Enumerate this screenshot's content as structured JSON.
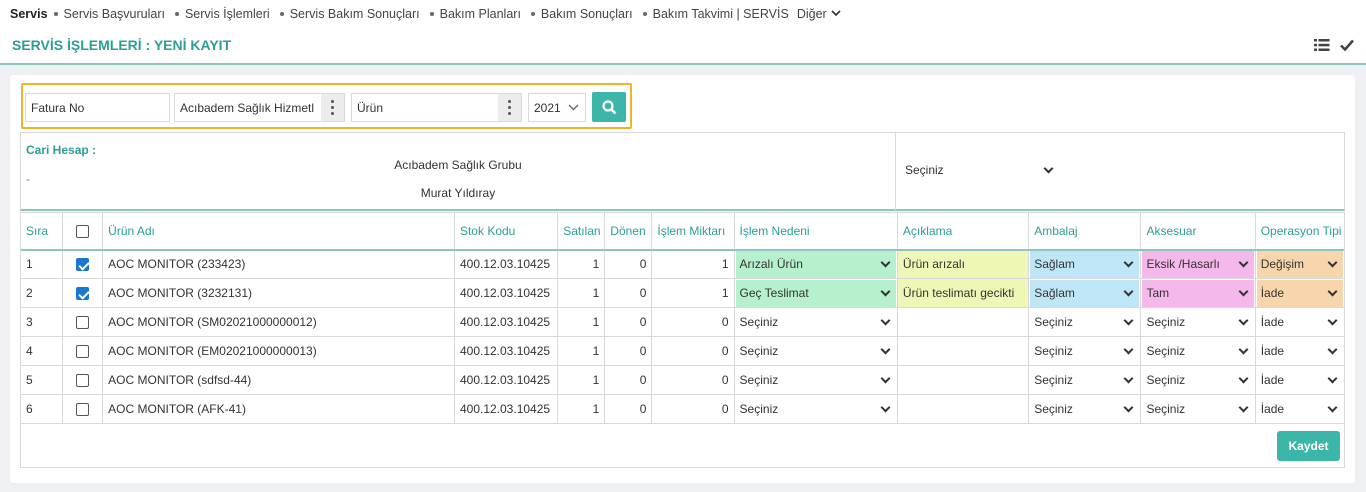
{
  "nav": {
    "brand": "Servis",
    "items": [
      "Servis Başvuruları",
      "Servis İşlemleri",
      "Servis Bakım Sonuçları",
      "Bakım Planları",
      "Bakım Sonuçları",
      "Bakım Takvimi | SERVİS"
    ],
    "more": "Diğer"
  },
  "page": {
    "title": "SERVİS İŞLEMLERİ : YENİ KAYIT"
  },
  "search": {
    "invoice_placeholder": "Fatura No",
    "account_value": "Acıbadem  Sağlık Hizmetl",
    "product_placeholder": "Ürün",
    "year_value": "2021"
  },
  "cari": {
    "label": "Cari Hesap :",
    "dash": "-",
    "group_name": "Acıbadem Sağlık Grubu",
    "contact_name": "Murat Yıldıray",
    "select_value": "Seçiniz"
  },
  "table": {
    "headers": {
      "sira": "Sıra",
      "urun_adi": "Ürün Adı",
      "stok_kodu": "Stok Kodu",
      "satilan": "Satılan",
      "donen": "Dönen",
      "islem_miktari": "İşlem Miktarı",
      "islem_nedeni": "İşlem Nedeni",
      "aciklama": "Açıklama",
      "ambalaj": "Ambalaj",
      "aksesuar": "Aksesuar",
      "operasyon_tipi": "Operasyon Tipi"
    },
    "rows": [
      {
        "sira": "1",
        "checked": true,
        "urun_adi": "AOC MONITOR (233423)",
        "stok_kodu": "400.12.03.10425",
        "satilan": "1",
        "donen": "0",
        "miktar": "1",
        "neden": "Arızalı Ürün",
        "aciklama": "Ürün arızalı",
        "ambalaj": "Sağlam",
        "aksesuar": "Eksik /Hasarlı",
        "operasyon": "Değişim"
      },
      {
        "sira": "2",
        "checked": true,
        "urun_adi": "AOC MONITOR (3232131)",
        "stok_kodu": "400.12.03.10425",
        "satilan": "1",
        "donen": "0",
        "miktar": "1",
        "neden": "Geç Teslimat",
        "aciklama": "Ürün teslimatı gecikti",
        "ambalaj": "Sağlam",
        "aksesuar": "Tam",
        "operasyon": "İade"
      },
      {
        "sira": "3",
        "checked": false,
        "urun_adi": "AOC MONITOR (SM02021000000012)",
        "stok_kodu": "400.12.03.10425",
        "satilan": "1",
        "donen": "0",
        "miktar": "0",
        "neden": "Seçiniz",
        "aciklama": "",
        "ambalaj": "Seçiniz",
        "aksesuar": "Seçiniz",
        "operasyon": "İade"
      },
      {
        "sira": "4",
        "checked": false,
        "urun_adi": "AOC MONITOR (EM02021000000013)",
        "stok_kodu": "400.12.03.10425",
        "satilan": "1",
        "donen": "0",
        "miktar": "0",
        "neden": "Seçiniz",
        "aciklama": "",
        "ambalaj": "Seçiniz",
        "aksesuar": "Seçiniz",
        "operasyon": "İade"
      },
      {
        "sira": "5",
        "checked": false,
        "urun_adi": "AOC MONITOR (sdfsd-44)",
        "stok_kodu": "400.12.03.10425",
        "satilan": "1",
        "donen": "0",
        "miktar": "0",
        "neden": "Seçiniz",
        "aciklama": "",
        "ambalaj": "Seçiniz",
        "aksesuar": "Seçiniz",
        "operasyon": "İade"
      },
      {
        "sira": "6",
        "checked": false,
        "urun_adi": "AOC MONITOR (AFK-41)",
        "stok_kodu": "400.12.03.10425",
        "satilan": "1",
        "donen": "0",
        "miktar": "0",
        "neden": "Seçiniz",
        "aciklama": "",
        "ambalaj": "Seçiniz",
        "aksesuar": "Seçiniz",
        "operasyon": "İade"
      }
    ]
  },
  "actions": {
    "save_label": "Kaydet"
  },
  "colors": {
    "accent": "#3cb6a8",
    "title": "#2b9e95",
    "highlight_border": "#f0b429"
  },
  "icons": [
    "list-icon",
    "check-icon",
    "search-icon",
    "chevron-down-icon",
    "kebab-menu-icon"
  ]
}
